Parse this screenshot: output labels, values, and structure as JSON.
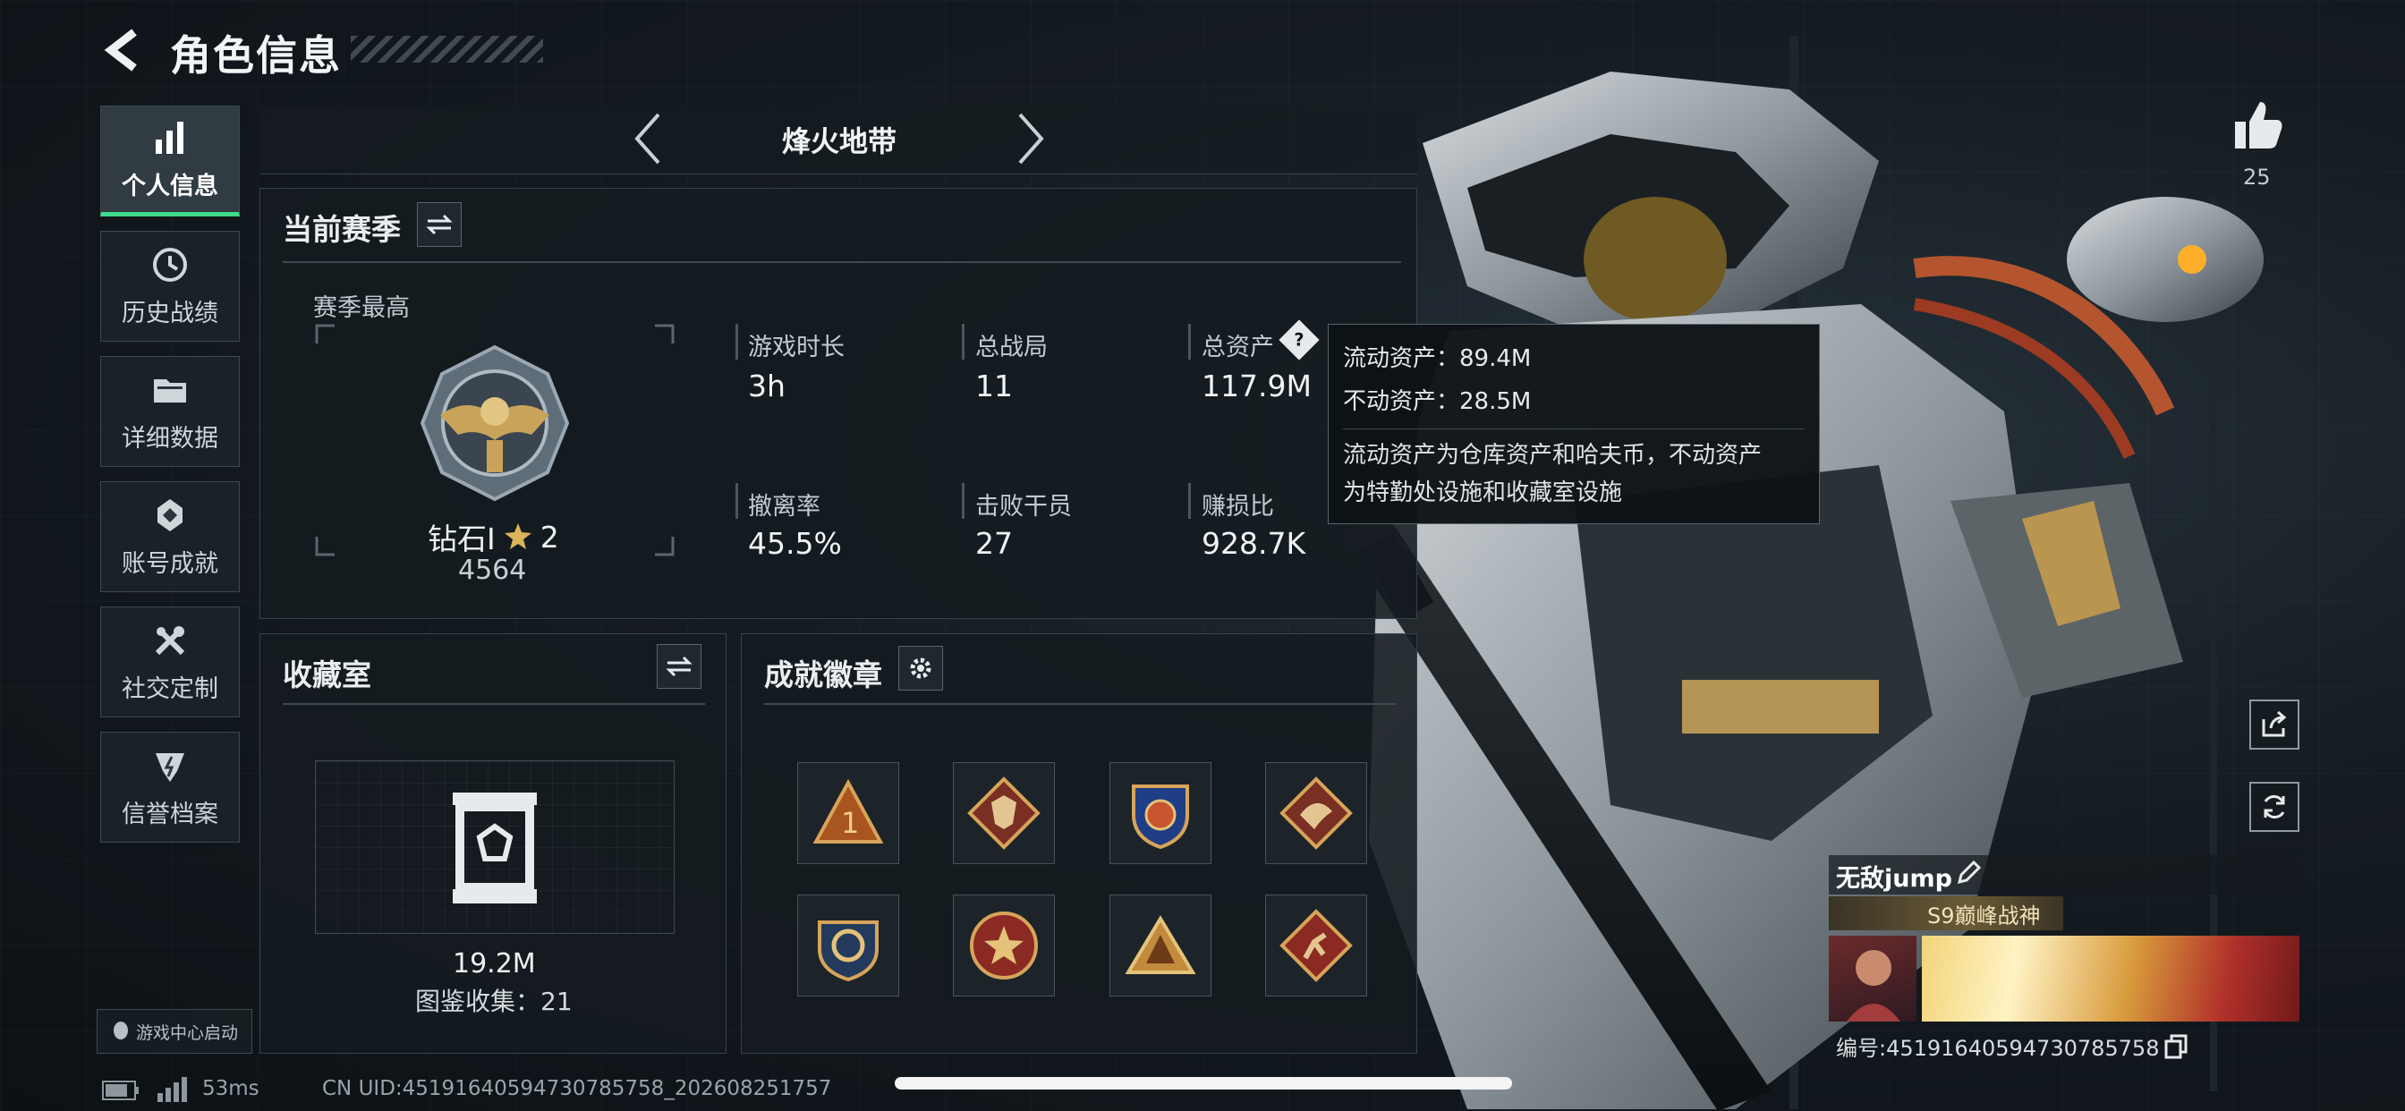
{
  "header": {
    "title": "角色信息"
  },
  "sidebar": {
    "items": [
      {
        "label": "个人信息",
        "icon": "bar-chart-icon",
        "active": true
      },
      {
        "label": "历史战绩",
        "icon": "history-icon"
      },
      {
        "label": "详细数据",
        "icon": "folder-icon"
      },
      {
        "label": "账号成就",
        "icon": "achievement-icon"
      },
      {
        "label": "社交定制",
        "icon": "tools-icon"
      },
      {
        "label": "信誉档案",
        "icon": "credit-icon"
      }
    ],
    "launcher_label": "游戏中心启动"
  },
  "mode_selector": {
    "current": "烽火地带"
  },
  "season": {
    "title": "当前赛季",
    "best_label": "赛季最高",
    "rank_name": "钻石Ⅰ",
    "rank_stars": "2",
    "rank_score": "4564",
    "stats": [
      {
        "label": "游戏时长",
        "value": "3h"
      },
      {
        "label": "总战局",
        "value": "11"
      },
      {
        "label": "总资产",
        "value": "117.9M"
      },
      {
        "label": "撤离率",
        "value": "45.5%"
      },
      {
        "label": "击败干员",
        "value": "27"
      },
      {
        "label": "赚损比",
        "value": "928.7K"
      }
    ]
  },
  "tooltip": {
    "liquid": "流动资产：89.4M",
    "fixed": "不动资产：28.5M",
    "desc_line1": "流动资产为仓库资产和哈夫币，不动资产",
    "desc_line2": "为特勤处设施和收藏室设施"
  },
  "collection": {
    "title": "收藏室",
    "value": "19.2M",
    "catalog": "图鉴收集：21"
  },
  "achievements": {
    "title": "成就徽章",
    "badges": [
      "triangle-badge",
      "wolf-badge",
      "shield-badge",
      "dragon-badge",
      "anchor-badge",
      "star-badge",
      "pyramid-badge",
      "runner-badge"
    ]
  },
  "likes": {
    "count": "25"
  },
  "profile": {
    "name": "无敌jump",
    "title": "S9巅峰战神",
    "id": "编号:451916405947307857​58"
  },
  "footer": {
    "ping": "53ms",
    "uid": "CN UID:45191640594730785758_202608251757"
  },
  "colors": {
    "accent": "#3ed98a",
    "gold": "#c9a35a"
  }
}
